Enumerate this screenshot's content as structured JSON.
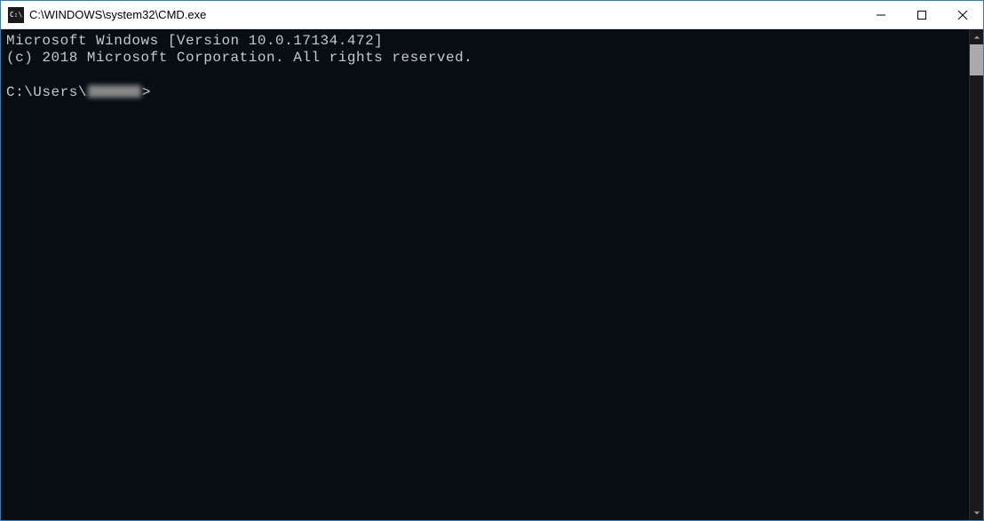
{
  "window": {
    "title": "C:\\WINDOWS\\system32\\CMD.exe",
    "icon_label": "C:\\"
  },
  "console": {
    "line1": "Microsoft Windows [Version 10.0.17134.472]",
    "line2": "(c) 2018 Microsoft Corporation. All rights reserved.",
    "prompt_prefix": "C:\\Users\\",
    "prompt_suffix": ">"
  }
}
